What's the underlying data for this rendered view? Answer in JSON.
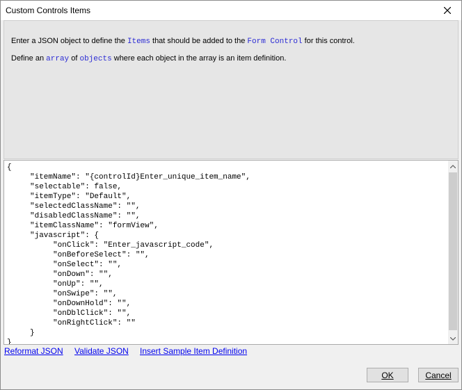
{
  "window": {
    "title": "Custom Controls Items"
  },
  "info": {
    "line1": {
      "pre": "Enter a JSON object to define the ",
      "code1": "Items",
      "mid": " that should be added to the ",
      "code2": "Form Control",
      "post": " for this control."
    },
    "line2": {
      "pre": "Define an ",
      "code1": "array",
      "mid": " of ",
      "code2": "objects",
      "post": " where each object in the array is an item definition."
    }
  },
  "editor": {
    "text": "{\n     \"itemName\": \"{controlId}Enter_unique_item_name\",\n     \"selectable\": false,\n     \"itemType\": \"Default\",\n     \"selectedClassName\": \"\",\n     \"disabledClassName\": \"\",\n     \"itemClassName\": \"formView\",\n     \"javascript\": {\n          \"onClick\": \"Enter_javascript_code\",\n          \"onBeforeSelect\": \"\",\n          \"onSelect\": \"\",\n          \"onDown\": \"\",\n          \"onUp\": \"\",\n          \"onSwipe\": \"\",\n          \"onDownHold\": \"\",\n          \"onDblClick\": \"\",\n          \"onRightClick\": \"\"\n     }\n}"
  },
  "links": {
    "reformat": "Reformat JSON",
    "validate": "Validate JSON",
    "insert": "Insert Sample Item Definition"
  },
  "buttons": {
    "ok": "OK",
    "cancel": "Cancel"
  },
  "icons": {
    "close": "close-icon",
    "scroll_up": "chevron-up-icon",
    "scroll_down": "chevron-down-icon"
  }
}
